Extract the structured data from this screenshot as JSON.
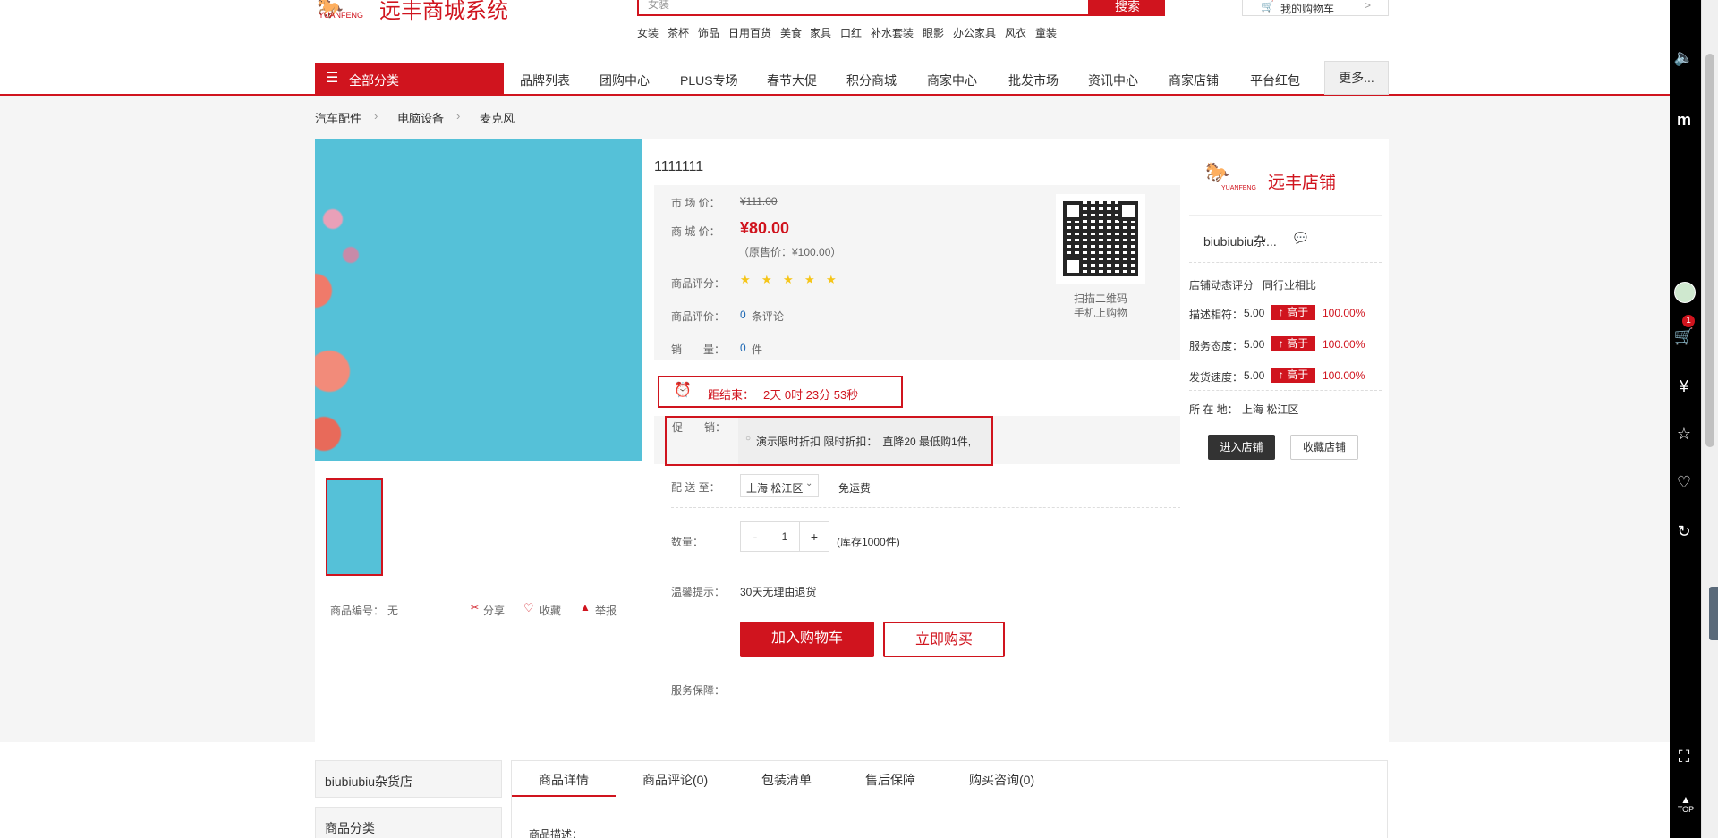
{
  "header": {
    "logo_text": "远丰商城系统",
    "logo_sub": "YUANFENG",
    "search_placeholder": "女装",
    "search_button": "搜索",
    "hot_words": [
      "女装",
      "茶杯",
      "饰品",
      "日用百货",
      "美食",
      "家具",
      "口红",
      "补水套装",
      "眼影",
      "办公家具",
      "风衣",
      "童装"
    ],
    "cart_label": "我的购物车"
  },
  "nav": {
    "all_categories": "全部分类",
    "items": [
      "品牌列表",
      "团购中心",
      "PLUS专场",
      "春节大促",
      "积分商城",
      "商家中心",
      "批发市场",
      "资讯中心",
      "商家店铺",
      "平台红包"
    ],
    "more": "更多..."
  },
  "breadcrumb": [
    "汽车配件",
    "电脑设备",
    "麦克风"
  ],
  "product": {
    "title": "1111111",
    "market_price_label": "市 场 价：",
    "market_price": "¥111.00",
    "mall_price_label": "商 城 价：",
    "mall_price": "¥80.00",
    "original_price": "（原售价：¥100.00）",
    "rating_label": "商品评分：",
    "rating_stars": 5,
    "review_label": "商品评价：",
    "review_count": "0",
    "review_unit": "条评论",
    "sales_label": "销　　量：",
    "sales_count": "0",
    "sales_unit": "件",
    "qr_caption_1": "扫描二维码",
    "qr_caption_2": "手机上购物",
    "countdown_label": "距结束：",
    "countdown_value": "2天 0时 23分 53秒",
    "promo_label": "促　　销：",
    "promo_text": "演示限时折扣 限时折扣：　直降20 最低购1件,",
    "ship_label": "配 送 至：",
    "ship_region": "上海 松江区",
    "ship_fee": "免运费",
    "qty_label": "数量：",
    "qty_minus": "-",
    "qty_value": "1",
    "qty_plus": "+",
    "stock": "(库存1000件)",
    "tip_label": "温馨提示：",
    "tip_text": "30天无理由退货",
    "add_cart": "加入购物车",
    "buy_now": "立即购买",
    "service_label": "服务保障：",
    "sku_label": "商品编号：",
    "sku_value": "无",
    "share": "分享",
    "favorite": "收藏",
    "report": "举报"
  },
  "store": {
    "logo_text": "远丰店铺",
    "logo_sub": "YUANFENG",
    "name": "biubiubiu杂...",
    "score_title": "店铺动态评分",
    "compare_title": "同行业相比",
    "scores": [
      {
        "label": "描述相符：",
        "value": "5.00",
        "badge": "↑ 高于",
        "pct": "100.00%"
      },
      {
        "label": "服务态度：",
        "value": "5.00",
        "badge": "↑ 高于",
        "pct": "100.00%"
      },
      {
        "label": "发货速度：",
        "value": "5.00",
        "badge": "↑ 高于",
        "pct": "100.00%"
      }
    ],
    "location_label": "所 在 地：",
    "location": "上海 松江区",
    "enter_store": "进入店铺",
    "fav_store": "收藏店铺"
  },
  "bottom": {
    "shop_name": "biubiubiu杂货店",
    "category_title": "商品分类",
    "tabs": [
      "商品详情",
      "商品评论(0)",
      "包装清单",
      "售后保障",
      "购买咨询(0)"
    ],
    "desc_label": "商品描述："
  },
  "sidebar": {
    "cart_badge": "1",
    "top_label": "TOP"
  },
  "colors": {
    "brand": "#d0141e",
    "bg_gray": "#f5f5f5"
  }
}
